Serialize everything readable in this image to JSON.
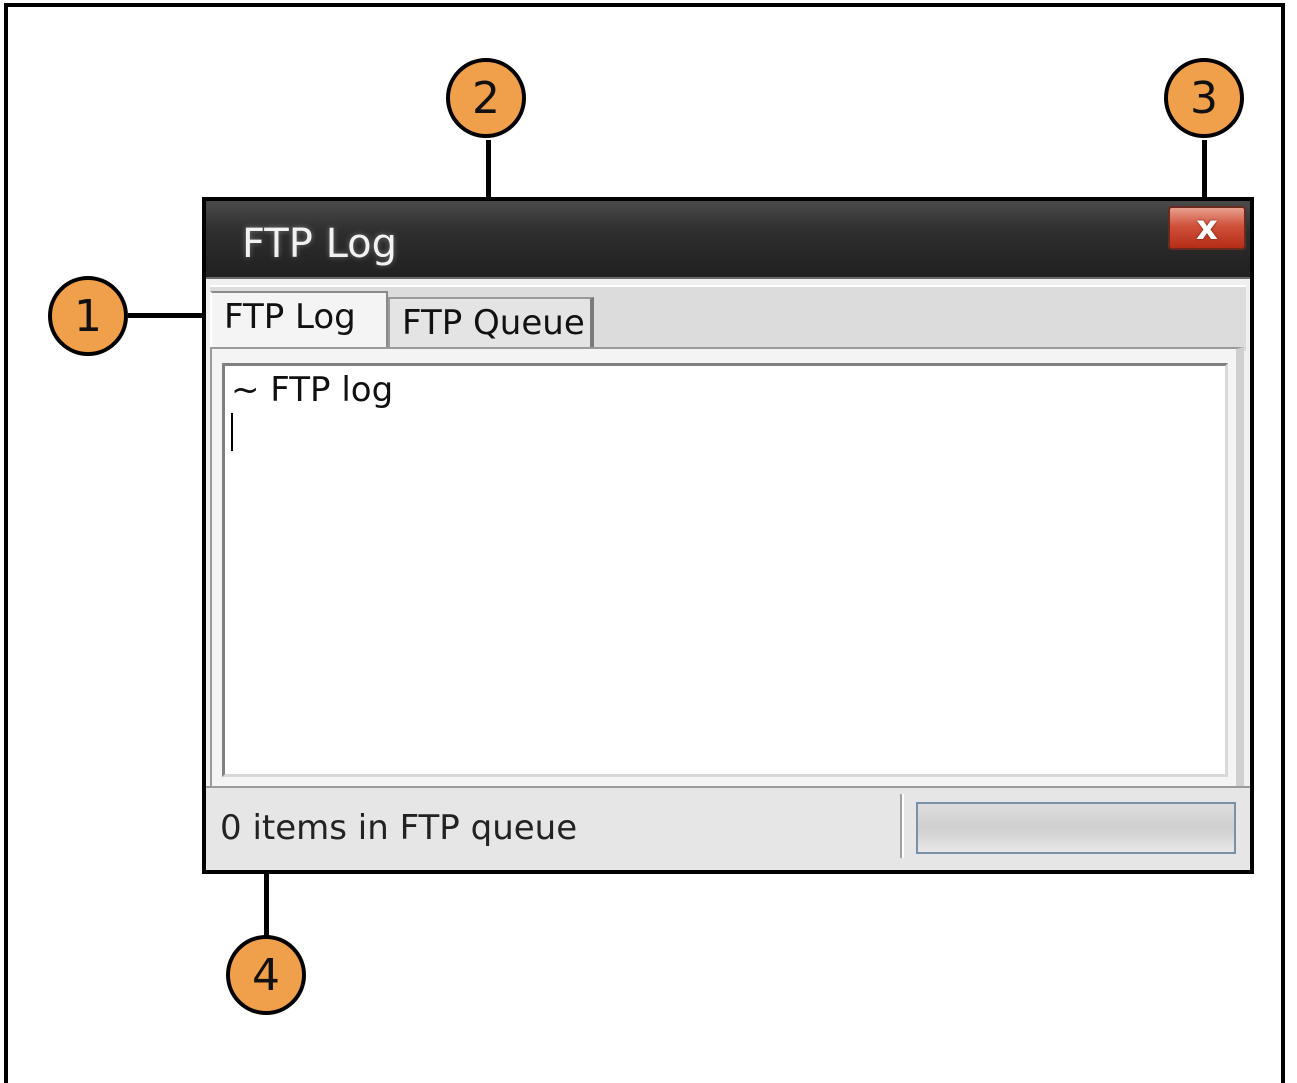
{
  "window": {
    "title": "FTP Log",
    "close_label": "x"
  },
  "tabs": [
    {
      "label": "FTP Log",
      "active": true
    },
    {
      "label": "FTP Queue",
      "active": false
    }
  ],
  "log": {
    "content": "~ FTP log"
  },
  "status": {
    "text": "0 items in FTP queue",
    "progress": 0
  },
  "callouts": [
    "1",
    "2",
    "3",
    "4"
  ],
  "colors": {
    "callout_fill": "#f0a04a",
    "close_button": "#d0513a",
    "titlebar": "#2e2e2e"
  }
}
